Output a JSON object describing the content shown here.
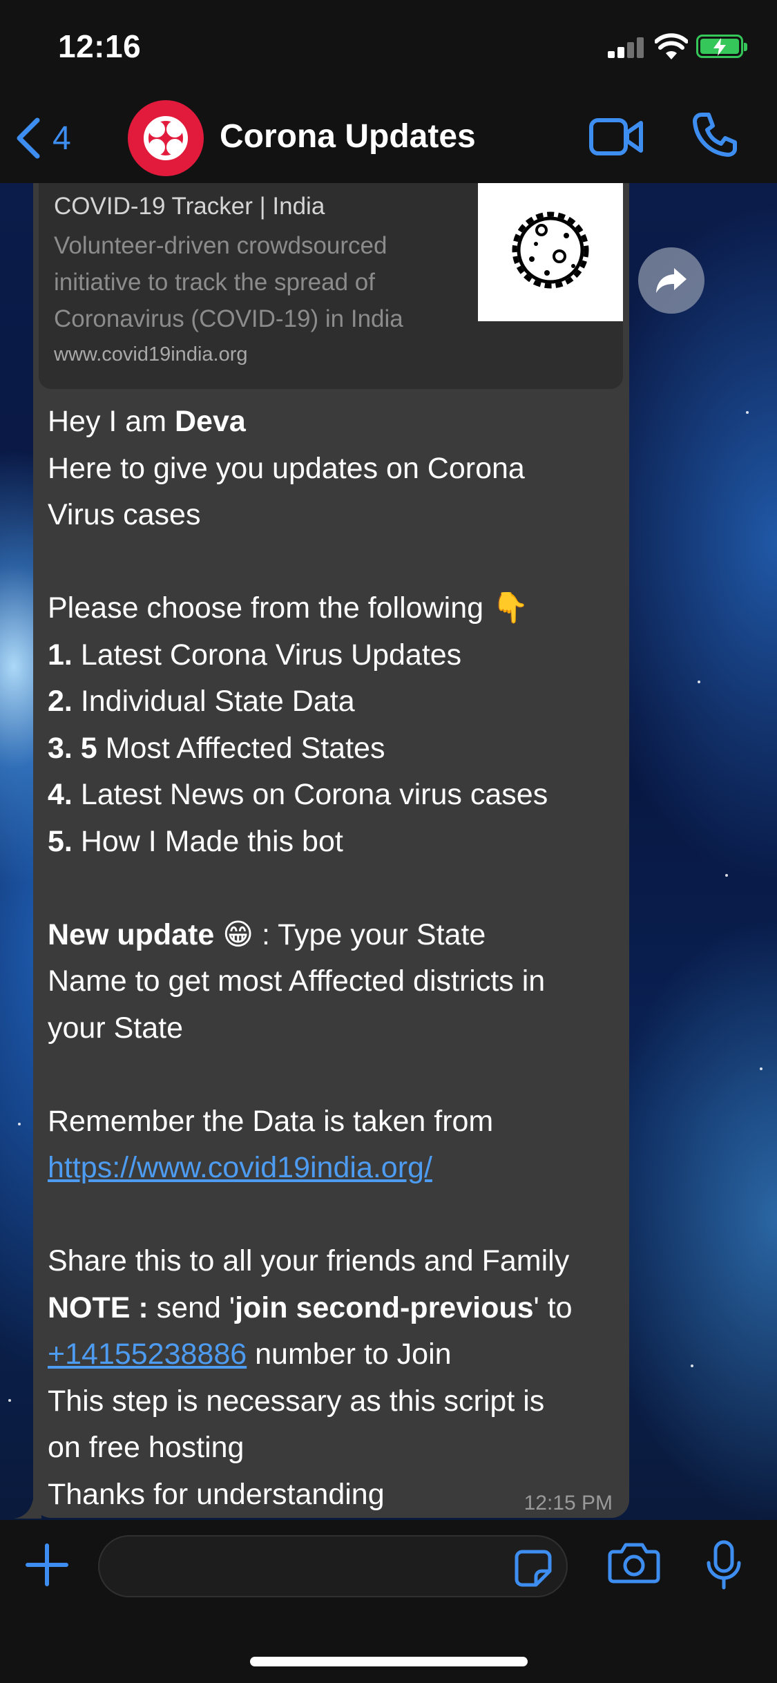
{
  "status_bar": {
    "time": "12:16"
  },
  "nav": {
    "back_count": "4",
    "chat_title": "Corona Updates"
  },
  "link_preview": {
    "title": "COVID-19 Tracker | India",
    "description": "Volunteer-driven crowdsourced initiative to track the spread of Coronavirus (COVID-19) in India",
    "url": "www.covid19india.org"
  },
  "message": {
    "greet_prefix": "Hey I am ",
    "greet_name": "Deva",
    "line_intro_1": "Here to give you updates on Corona",
    "line_intro_2": "Virus cases",
    "choose": "Please choose from the following ",
    "choose_emoji": "👇",
    "opt1_num": "1.",
    "opt1": " Latest Corona Virus Updates",
    "opt2_num": "2.",
    "opt2": " Individual State Data",
    "opt3_num": "3. 5",
    "opt3": " Most Afffected States",
    "opt4_num": "4.",
    "opt4": " Latest News on Corona virus cases",
    "opt5_num": "5.",
    "opt5": " How I Made this bot",
    "update_label": "New update",
    "update_emoji": "😁",
    "update_text_1": " : Type your State",
    "update_text_2": "Name to get most Afffected districts in",
    "update_text_3": "your State",
    "remember": "Remember the Data is taken from",
    "source_link": "https://www.covid19india.org/",
    "share": "Share this to all your friends and Family",
    "note_label": "NOTE :",
    "note_send": " send '",
    "note_keyword": "join second-previous",
    "note_to": "' to",
    "phone": "+14155238886",
    "join_text": " number to Join",
    "step_1": "This step is necessary as this script is",
    "step_2": "on free hosting",
    "thanks": "Thanks for understanding",
    "time": "12:15 PM"
  },
  "input": {
    "placeholder": ""
  },
  "colors": {
    "accent": "#3d8ef0",
    "bubble": "#3b3b3b",
    "bar": "#121212",
    "avatar": "#e21b3c"
  },
  "icons": [
    "back-chevron-icon",
    "twilio-logo-icon",
    "video-call-icon",
    "phone-icon",
    "share-forward-icon",
    "plus-icon",
    "sticker-icon",
    "camera-icon",
    "microphone-icon",
    "virus-icon"
  ]
}
